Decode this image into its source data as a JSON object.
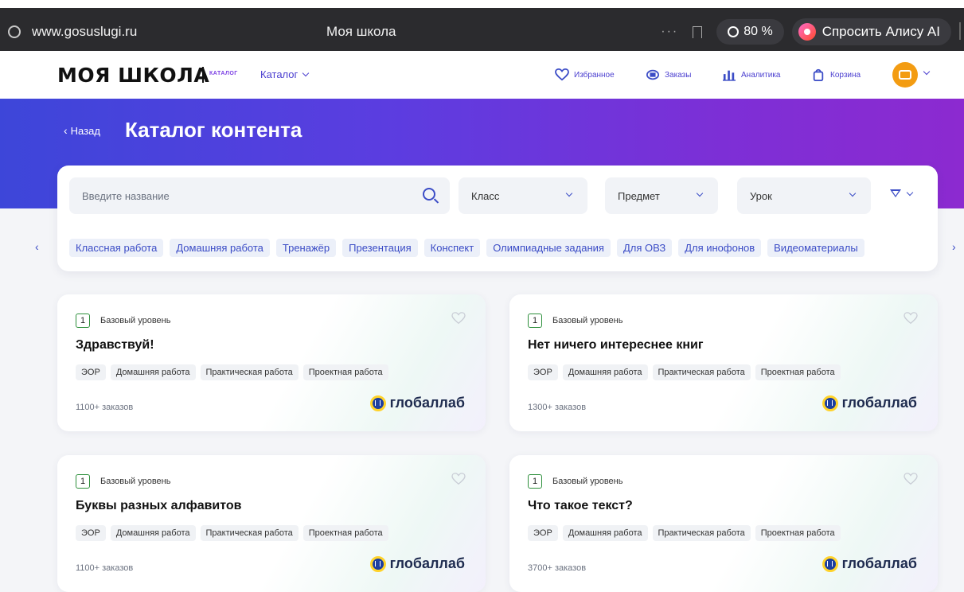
{
  "browser": {
    "url": "www.gosuslugi.ru",
    "tab_title": "Моя школа",
    "dots": "···",
    "zoom": "80 %",
    "alice_label": "Спросить Алису AI"
  },
  "header": {
    "logo": "МОЯ ШКОЛА",
    "logo_sub": "КАТАЛОГ",
    "catalog_label": "Каталог",
    "nav": {
      "favorites": "Избранное",
      "orders": "Заказы",
      "analytics": "Аналитика",
      "cart": "Корзина"
    }
  },
  "hero": {
    "back_label": "Назад",
    "title": "Каталог контента"
  },
  "filters": {
    "search_placeholder": "Введите название",
    "class_label": "Класс",
    "subject_label": "Предмет",
    "lesson_label": "Урок",
    "chips": [
      "Классная работа",
      "Домашняя работа",
      "Тренажёр",
      "Презентация",
      "Конспект",
      "Олимпиадные задания",
      "Для ОВЗ",
      "Для инофонов",
      "Видеоматериалы"
    ]
  },
  "cards": [
    {
      "grade": "1",
      "level": "Базовый уровень",
      "title": "Здравствуй!",
      "tags": [
        "ЭОР",
        "Домашняя работа",
        "Практическая работа",
        "Проектная работа"
      ],
      "orders": "1100+ заказов",
      "brand": "глобаллаб"
    },
    {
      "grade": "1",
      "level": "Базовый уровень",
      "title": "Нет ничего интереснее книг",
      "tags": [
        "ЭОР",
        "Домашняя работа",
        "Практическая работа",
        "Проектная работа"
      ],
      "orders": "1300+ заказов",
      "brand": "глобаллаб"
    },
    {
      "grade": "1",
      "level": "Базовый уровень",
      "title": "Буквы разных алфавитов",
      "tags": [
        "ЭОР",
        "Домашняя работа",
        "Практическая работа",
        "Проектная работа"
      ],
      "orders": "1100+ заказов",
      "brand": "глобаллаб"
    },
    {
      "grade": "1",
      "level": "Базовый уровень",
      "title": "Что такое текст?",
      "tags": [
        "ЭОР",
        "Домашняя работа",
        "Практическая работа",
        "Проектная работа"
      ],
      "orders": "3700+ заказов",
      "brand": "глобаллаб"
    }
  ]
}
